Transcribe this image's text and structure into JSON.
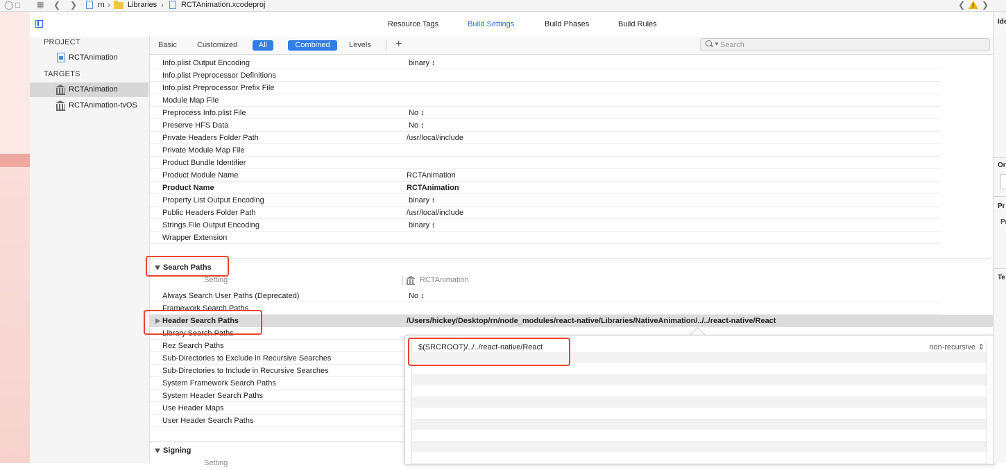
{
  "pathbar": {
    "segments": [
      "rn",
      "Libraries",
      "RCTAnimation.xcodeproj"
    ],
    "warning_count_symbol": "!"
  },
  "tabs": [
    {
      "label": "Resource Tags",
      "active": false
    },
    {
      "label": "Build Settings",
      "active": true
    },
    {
      "label": "Build Phases",
      "active": false
    },
    {
      "label": "Build Rules",
      "active": false
    }
  ],
  "sidebar": {
    "project_header": "PROJECT",
    "project_item": "RCTAnimation",
    "targets_header": "TARGETS",
    "targets": [
      {
        "label": "RCTAnimation",
        "selected": true
      },
      {
        "label": "RCTAnimation-tvOS",
        "selected": false
      }
    ]
  },
  "filterbar": {
    "basic": "Basic",
    "customized": "Customized",
    "all": "All",
    "combined": "Combined",
    "levels": "Levels",
    "add": "+",
    "search_placeholder": "Search"
  },
  "packaging_rows": [
    {
      "name": "Info.plist Output Encoding",
      "value": "binary ↕"
    },
    {
      "name": "Info.plist Preprocessor Definitions",
      "value": ""
    },
    {
      "name": "Info.plist Preprocessor Prefix File",
      "value": ""
    },
    {
      "name": "Module Map File",
      "value": ""
    },
    {
      "name": "Preprocess Info.plist File",
      "value": "No ↕"
    },
    {
      "name": "Preserve HFS Data",
      "value": "No ↕"
    },
    {
      "name": "Private Headers Folder Path",
      "value": "/usr/local/include"
    },
    {
      "name": "Private Module Map File",
      "value": ""
    },
    {
      "name": "Product Bundle Identifier",
      "value": ""
    },
    {
      "name": "Product Module Name",
      "value": "RCTAnimation"
    },
    {
      "name": "Product Name",
      "value": "RCTAnimation",
      "bold": true
    },
    {
      "name": "Property List Output Encoding",
      "value": "binary ↕"
    },
    {
      "name": "Public Headers Folder Path",
      "value": "/usr/local/include"
    },
    {
      "name": "Strings File Output Encoding",
      "value": "binary ↕"
    },
    {
      "name": "Wrapper Extension",
      "value": ""
    }
  ],
  "search_paths": {
    "title": "Search Paths",
    "col_setting": "Setting",
    "col_target": "RCTAnimation",
    "rows": [
      {
        "name": "Always Search User Paths (Deprecated)",
        "value": "No ↕"
      },
      {
        "name": "Framework Search Paths",
        "value": ""
      },
      {
        "name": "Header Search Paths",
        "value": "/Users/hickey/Desktop/rn/node_modules/react-native/Libraries/NativeAnimation/../../react-native/React",
        "bold": true,
        "highlighted": true
      },
      {
        "name": "Library Search Paths",
        "value": ""
      },
      {
        "name": "Rez Search Paths",
        "value": ""
      },
      {
        "name": "Sub-Directories to Exclude in Recursive Searches",
        "value": ""
      },
      {
        "name": "Sub-Directories to Include in Recursive Searches",
        "value": ""
      },
      {
        "name": "System Framework Search Paths",
        "value": ""
      },
      {
        "name": "System Header Search Paths",
        "value": ""
      },
      {
        "name": "Use Header Maps",
        "value": ""
      },
      {
        "name": "User Header Search Paths",
        "value": ""
      }
    ]
  },
  "signing": {
    "title": "Signing",
    "col_setting": "Setting"
  },
  "popover": {
    "entry_value": "$(SRCROOT)/../../react-native/React",
    "entry_recursion": "non-recursive"
  },
  "inspector": {
    "labels": [
      "Ide",
      "Or",
      "Pr",
      "Pr",
      "Te"
    ]
  },
  "colors": {
    "accent": "#2f7fe6",
    "annotation": "#e8452c",
    "warning": "#f2b300"
  }
}
